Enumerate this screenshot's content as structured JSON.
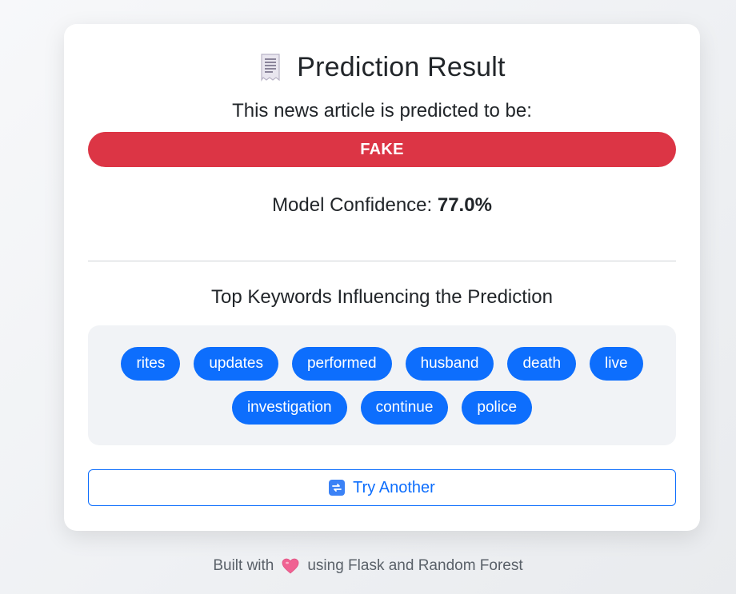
{
  "header": {
    "icon": "receipt-icon",
    "title": "Prediction Result"
  },
  "result": {
    "intro": "This news article is predicted to be:",
    "label": "FAKE",
    "color": "#dc3545"
  },
  "confidence": {
    "label": "Model Confidence: ",
    "value": "77.0%"
  },
  "keywords": {
    "heading": "Top Keywords Influencing the Prediction",
    "items": [
      "rites",
      "updates",
      "performed",
      "husband",
      "death",
      "live",
      "investigation",
      "continue",
      "police"
    ],
    "color": "#0d6efd"
  },
  "action": {
    "icon": "repeat-icon",
    "label": "Try Another"
  },
  "footer": {
    "before": "Built with",
    "icon": "heart-icon",
    "after": "using Flask and Random Forest"
  }
}
